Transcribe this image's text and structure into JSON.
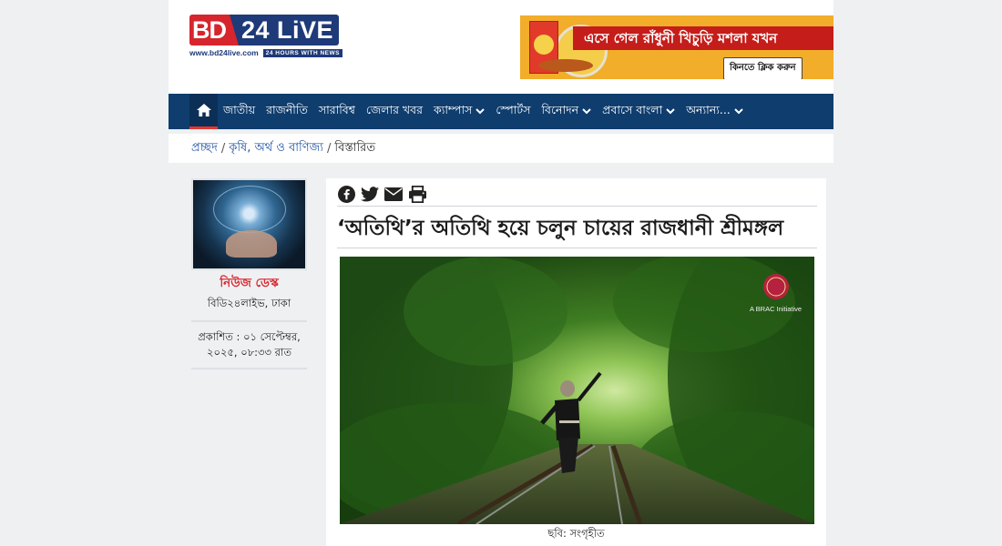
{
  "header": {
    "logo_bd": "BD",
    "logo_live": "24 LiVE",
    "logo_url": "www.bd24live.com",
    "logo_tagline": "24 HOURS WITH NEWS",
    "ad_text_1": "এসে গেল রাঁধুনী খিচুড়ি মশলা",
    "ad_text_2": "যখন",
    "ad_button": "কিনতে ক্লিক করুন"
  },
  "nav": {
    "home_icon": "home-icon",
    "items": [
      {
        "label": "জাতীয়",
        "dropdown": false
      },
      {
        "label": "রাজনীতি",
        "dropdown": false
      },
      {
        "label": "সারাবিশ্ব",
        "dropdown": false
      },
      {
        "label": "জেলার খবর",
        "dropdown": false
      },
      {
        "label": "ক্যাম্পাস",
        "dropdown": true
      },
      {
        "label": "স্পোর্টস",
        "dropdown": false
      },
      {
        "label": "বিনোদন",
        "dropdown": true
      },
      {
        "label": "প্রবাসে বাংলা",
        "dropdown": true
      },
      {
        "label": "অন্যান্য...",
        "dropdown": true
      }
    ]
  },
  "breadcrumb": {
    "home": "প্রচ্ছদ",
    "category": "কৃষি, অর্থ ও বাণিজ্য",
    "current": "বিস্তারিত",
    "separator": "/"
  },
  "author": {
    "name": "নিউজ ডেস্ক",
    "location": "বিডি২৪লাইভ, ঢাকা",
    "published_line1": "প্রকাশিত : ০১ সেপ্টেম্বর,",
    "published_line2": "২০২৫, ০৮:৩৩ রাত"
  },
  "article": {
    "share_icons": [
      "facebook-icon",
      "twitter-icon",
      "email-icon",
      "print-icon"
    ],
    "headline": "‘অতিথি’র অতিথি হয়ে চলুন চায়ের রাজধানী শ্রীমঙ্গল",
    "photo_badge": "A BRAC Initiative",
    "caption": "ছবি: সংগৃহীত"
  },
  "colors": {
    "brand_red": "#d7252d",
    "brand_blue": "#1e3a78",
    "nav_bg": "#0f3d6e",
    "link": "#1a4fa1"
  }
}
